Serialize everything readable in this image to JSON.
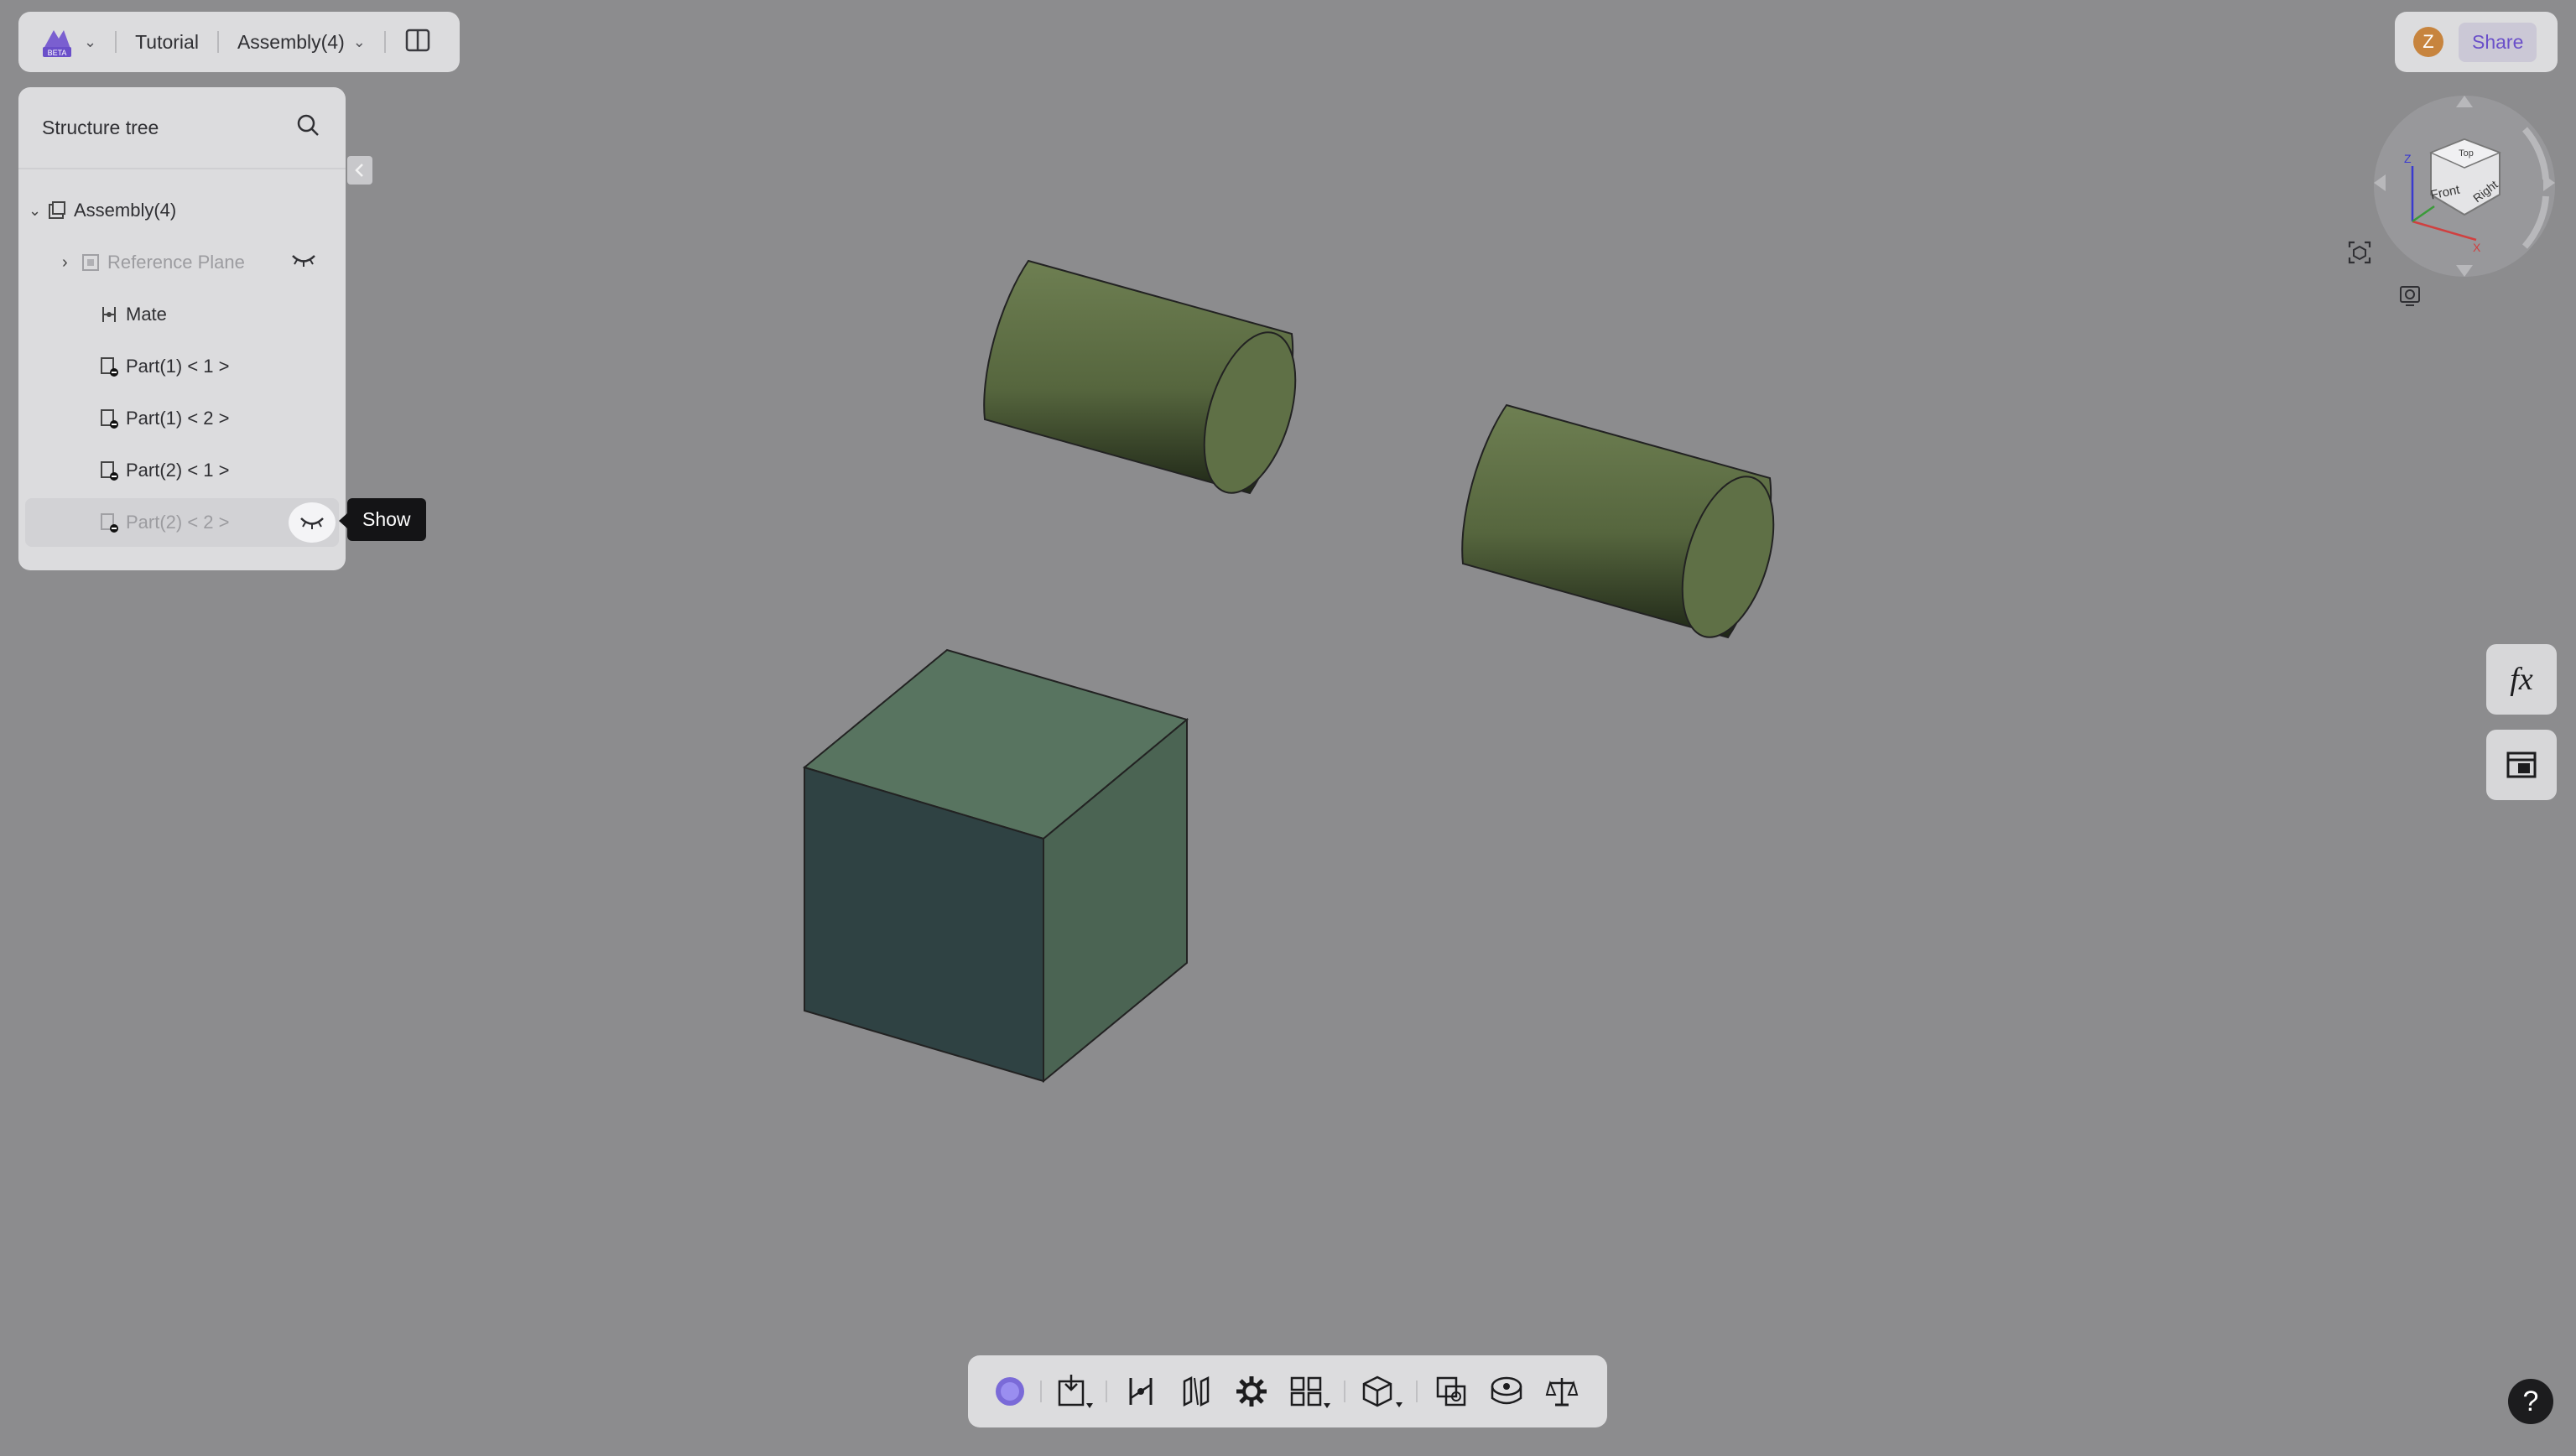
{
  "app": {
    "logo_badge": "BETA",
    "project": "Tutorial",
    "document": "Assembly(4)"
  },
  "header_right": {
    "avatar_initial": "Z",
    "share_label": "Share"
  },
  "structure_tree": {
    "title": "Structure tree",
    "root": "Assembly(4)",
    "items": [
      {
        "label": "Reference Plane",
        "hidden": true
      },
      {
        "label": "Mate",
        "hidden": false
      },
      {
        "label": "Part(1) < 1 >",
        "hidden": false
      },
      {
        "label": "Part(1) < 2 >",
        "hidden": false
      },
      {
        "label": "Part(2) < 1 >",
        "hidden": false
      },
      {
        "label": "Part(2) < 2 >",
        "hidden": true
      }
    ]
  },
  "tooltip": "Show",
  "view_cube": {
    "top": "Top",
    "front": "Front",
    "right": "Right",
    "axis_z": "Z",
    "axis_x": "X"
  },
  "side_tools": {
    "formula": "fx"
  },
  "help": "?",
  "colors": {
    "background": "#8c8c8e",
    "accent": "#6a4fc9",
    "cylinder": "#5f7048",
    "cube_front": "#2f4243",
    "cube_top": "#587460",
    "cube_side": "#4b6453"
  },
  "icons": [
    "logo-icon",
    "chevron-down-icon",
    "split-view-icon",
    "search-icon",
    "chevron-right-icon",
    "assembly-icon",
    "reference-plane-icon",
    "mate-icon",
    "part-icon",
    "eye-closed-icon",
    "collapse-left-icon",
    "view-cube",
    "fit-view-icon",
    "render-mode-icon",
    "formula-icon",
    "table-icon",
    "help-icon"
  ]
}
